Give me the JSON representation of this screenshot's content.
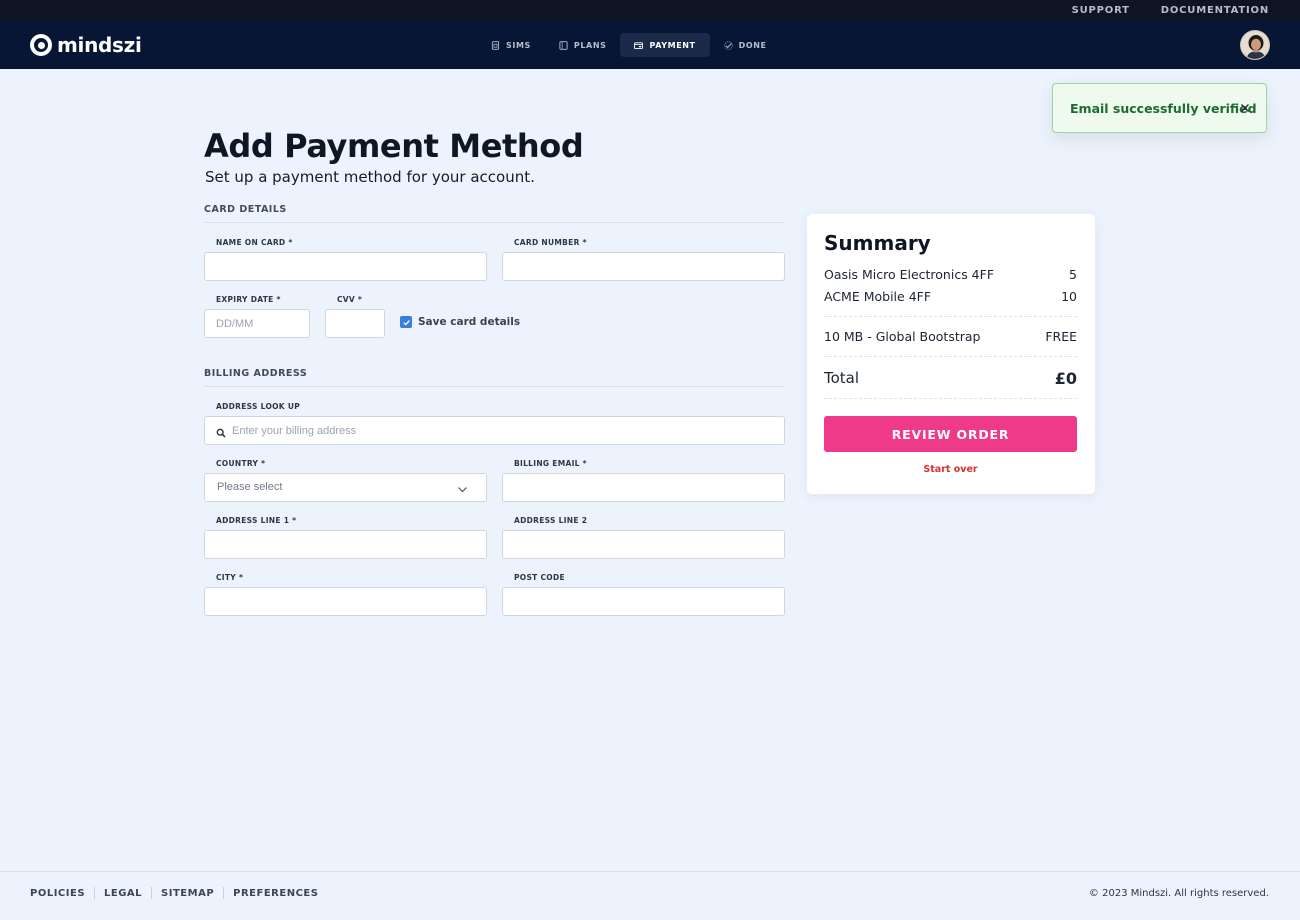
{
  "utility_nav": {
    "support": "SUPPORT",
    "documentation": "DOCUMENTATION"
  },
  "brand": {
    "name": "mindszi"
  },
  "steps": [
    {
      "label": "SIMS",
      "icon": "sim-icon",
      "active": false
    },
    {
      "label": "PLANS",
      "icon": "plans-icon",
      "active": false
    },
    {
      "label": "PAYMENT",
      "icon": "payment-card-icon",
      "active": true
    },
    {
      "label": "DONE",
      "icon": "done-icon",
      "active": false
    }
  ],
  "toast": {
    "message": "Email successfully verified",
    "close_icon": "close-icon"
  },
  "page": {
    "title": "Add Payment Method",
    "subtitle": "Set up a payment method for your account."
  },
  "card_details": {
    "section_label": "CARD DETAILS",
    "name_on_card_label": "NAME ON CARD *",
    "name_on_card_value": "",
    "card_number_label": "CARD NUMBER *",
    "card_number_value": "",
    "expiry_label": "EXPIRY DATE *",
    "expiry_placeholder": "DD/MM",
    "cvv_label": "CVV *",
    "cvv_value": "",
    "save_card_label": "Save card details",
    "save_card_checked": true
  },
  "billing": {
    "section_label": "BILLING ADDRESS",
    "lookup_label": "ADDRESS LOOK UP",
    "lookup_placeholder": "Enter your billing address",
    "country_label": "COUNTRY *",
    "country_selected": "Please select",
    "billing_email_label": "BILLING EMAIL *",
    "address1_label": "ADDRESS LINE 1 *",
    "address2_label": "ADDRESS LINE 2",
    "city_label": "CITY *",
    "postcode_label": "POST CODE"
  },
  "summary": {
    "title": "Summary",
    "items": [
      {
        "name": "Oasis Micro Electronics 4FF",
        "value": "5"
      },
      {
        "name": "ACME Mobile 4FF",
        "value": "10"
      }
    ],
    "plan": {
      "name": "10 MB - Global Bootstrap",
      "value": "FREE"
    },
    "total_label": "Total",
    "total_value": "£0",
    "review_button": "REVIEW ORDER",
    "start_over": "Start over"
  },
  "footer": {
    "links": [
      "POLICIES",
      "LEGAL",
      "SITEMAP",
      "PREFERENCES"
    ],
    "copyright": "© 2023 Mindszi. All rights reserved."
  },
  "colors": {
    "accent_pink": "#ee3a88",
    "nav_bg": "#061634",
    "page_bg": "#edf3fd",
    "success_green": "#1e6b2d",
    "danger_red": "#d8312f",
    "checkbox_blue": "#3b7ddd"
  }
}
